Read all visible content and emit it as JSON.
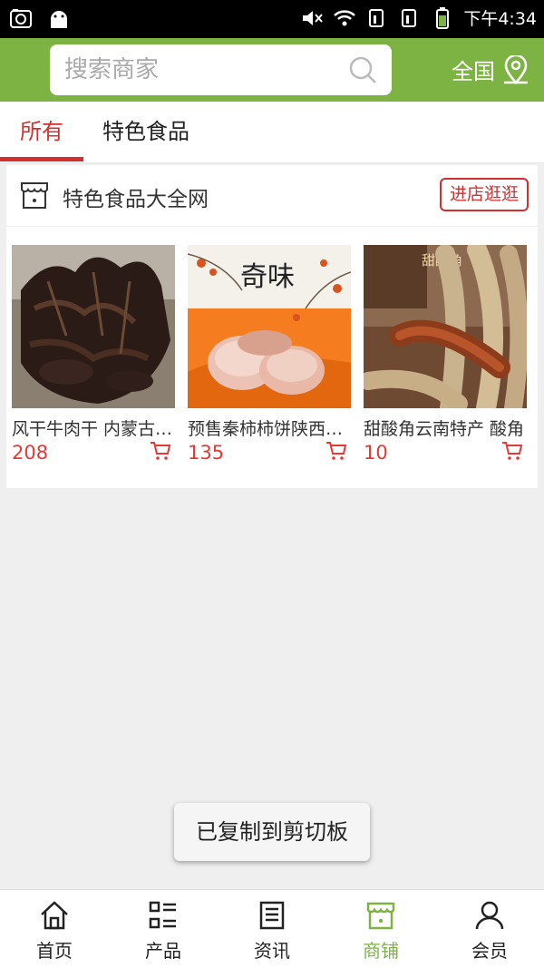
{
  "status_bar": {
    "time": "下午4:34"
  },
  "colors": {
    "brand_green": "#7cb342",
    "accent_red": "#d32f2f",
    "price_red": "#e53935"
  },
  "header": {
    "search_placeholder": "搜索商家",
    "region_label": "全国"
  },
  "tabs": [
    {
      "label": "所有",
      "active": true
    },
    {
      "label": "特色食品",
      "active": false
    }
  ],
  "shop": {
    "name": "特色食品大全网",
    "enter_label": "进店逛逛",
    "products": [
      {
        "name": "风干牛肉干 内蒙古特产",
        "price": "208",
        "image": "dried-beef-photo"
      },
      {
        "name": "预售秦柿柿饼陕西特产",
        "price": "135",
        "image": "persimmon-cake-photo",
        "image_text": "奇味"
      },
      {
        "name": "甜酸角云南特产 酸角",
        "price": "10",
        "image": "tamarind-photo",
        "image_text": "甜酸角"
      }
    ]
  },
  "toast": {
    "text": "已复制到剪切板"
  },
  "bottom_nav": [
    {
      "label": "首页",
      "icon": "home-icon",
      "active": false
    },
    {
      "label": "产品",
      "icon": "list-icon",
      "active": false
    },
    {
      "label": "资讯",
      "icon": "news-icon",
      "active": false
    },
    {
      "label": "商铺",
      "icon": "store-icon",
      "active": true
    },
    {
      "label": "会员",
      "icon": "user-icon",
      "active": false
    }
  ]
}
